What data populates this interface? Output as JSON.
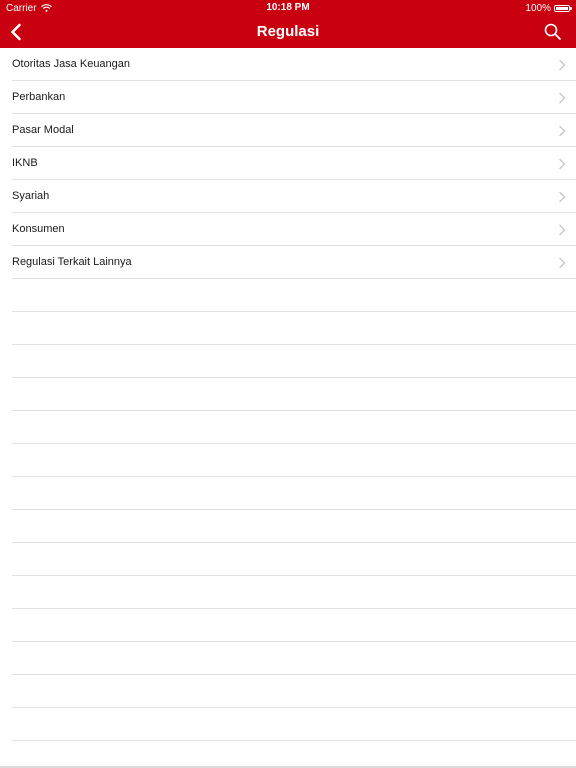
{
  "status_bar": {
    "carrier": "Carrier",
    "time": "10:18 PM",
    "battery": "100%",
    "battery_level": 1.0
  },
  "nav": {
    "title": "Regulasi",
    "back_icon": "chevron-left-icon",
    "search_icon": "search-icon"
  },
  "menu": {
    "items": [
      {
        "label": "Otoritas Jasa Keuangan"
      },
      {
        "label": "Perbankan"
      },
      {
        "label": "Pasar Modal"
      },
      {
        "label": "IKNB"
      },
      {
        "label": "Syariah"
      },
      {
        "label": "Konsumen"
      },
      {
        "label": "Regulasi Terkait Lainnya"
      }
    ]
  },
  "colors": {
    "accent": "#c8000f",
    "separator": "#e2e2e2",
    "chevron": "#c7c7cc"
  }
}
